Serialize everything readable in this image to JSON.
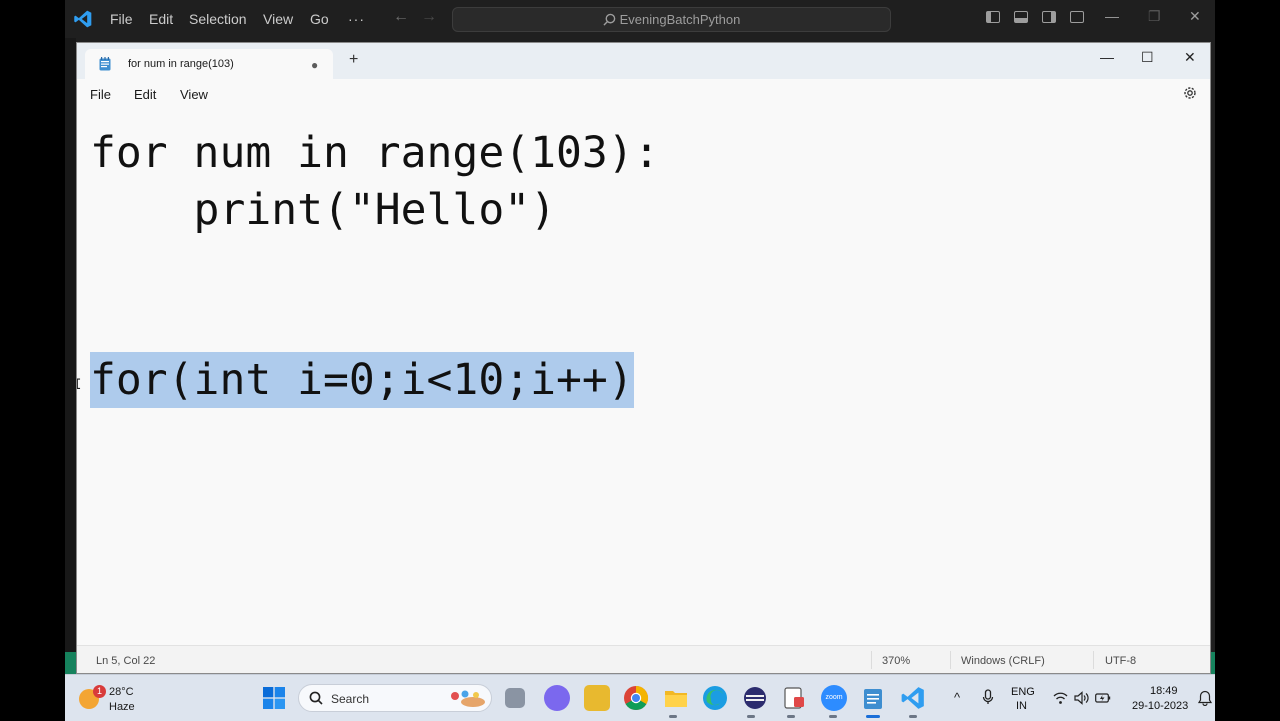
{
  "vscode": {
    "menu": [
      "File",
      "Edit",
      "Selection",
      "View",
      "Go"
    ],
    "more": "···",
    "search": "EveningBatchPython",
    "colors": {
      "accent": "#007acc",
      "statusbar": "#16825d"
    }
  },
  "notepad": {
    "tab_title": "for num in range(103)",
    "tab_modified": "●",
    "new_tab": "+",
    "window_buttons": {
      "minimize": "—",
      "maximize": "☐",
      "close": "✕"
    },
    "menu": [
      "File",
      "Edit",
      "View"
    ],
    "lines": [
      "for num in range(103):",
      "    print(\"Hello\")",
      "for(int i=0;i<10;i++)"
    ],
    "selected_line_index": 2,
    "status": {
      "position": "Ln 5, Col 22",
      "zoom": "370%",
      "line_ending": "Windows (CRLF)",
      "encoding": "UTF-8"
    },
    "colors": {
      "selection": "#aecbec"
    }
  },
  "taskbar": {
    "weather": {
      "badge": "1",
      "temp": "28°C",
      "desc": "Haze"
    },
    "search_placeholder": "Search",
    "apps": [
      "task-view-icon",
      "teams-icon",
      "app-icon",
      "chrome-icon",
      "file-explorer-icon",
      "edge-icon",
      "media-icon",
      "snipping-tool-icon",
      "zoom-icon",
      "notepad-icon",
      "vscode-icon"
    ],
    "zoom_label": "zoom",
    "tray": {
      "chevron": "^",
      "lang_line1": "ENG",
      "lang_line2": "IN",
      "time": "18:49",
      "date": "29-10-2023"
    }
  }
}
